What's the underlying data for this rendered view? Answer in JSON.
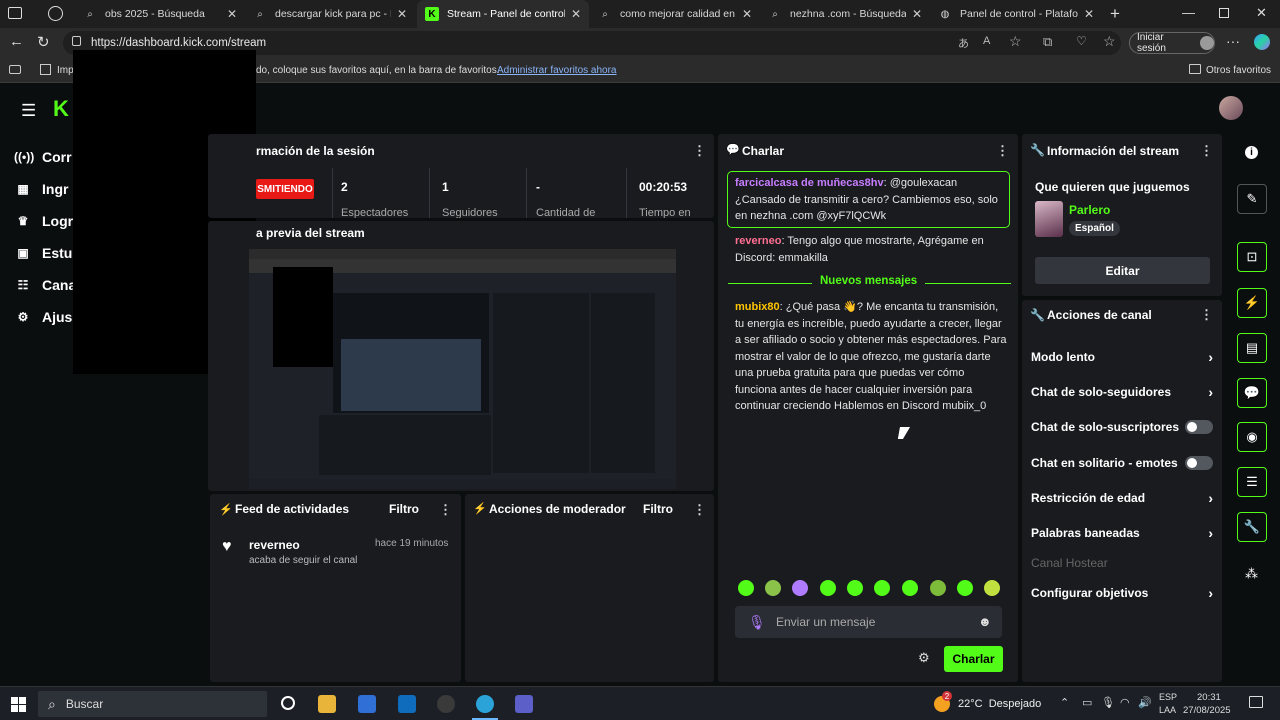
{
  "browser": {
    "tabs": [
      {
        "title": "obs 2025 - Búsqueda",
        "icon": "search-icon"
      },
      {
        "title": "descargar kick para pc - Búsque",
        "icon": "search-icon"
      },
      {
        "title": "Stream - Panel de control de",
        "icon": "kick-icon",
        "active": true
      },
      {
        "title": "como mejorar calidad en kick",
        "icon": "search-icon"
      },
      {
        "title": "nezhna .com - Búsqueda",
        "icon": "search-icon"
      },
      {
        "title": "Panel de control - Plataforma",
        "icon": "globe-icon"
      }
    ],
    "url": "https://dashboard.kick.com/stream",
    "signin_label": "Iniciar sesión",
    "favbar_prefix": "Imp",
    "favbar_text": "do, coloque sus favoritos aquí, en la barra de favoritos.",
    "favbar_link": "Administrar favoritos ahora",
    "other_favs": "Otros favoritos"
  },
  "sidebar": {
    "items": [
      {
        "label": "Corr",
        "icon": "broadcast-icon"
      },
      {
        "label": "Ingr",
        "icon": "chart-icon"
      },
      {
        "label": "Logr",
        "icon": "trophy-icon"
      },
      {
        "label": "Estu",
        "icon": "studio-icon"
      },
      {
        "label": "Cana",
        "icon": "channel-icon"
      },
      {
        "label": "Ajus",
        "icon": "gear-icon"
      }
    ]
  },
  "session": {
    "title": "rmación de la sesión",
    "live_badge": "SMITIENDO",
    "stats": [
      {
        "value": "2",
        "label": "Espectadores"
      },
      {
        "value": "1",
        "label": "Seguidores"
      },
      {
        "value": "-",
        "label": "Cantidad de"
      },
      {
        "value": "00:20:53",
        "label": "Tiempo en"
      }
    ]
  },
  "preview": {
    "title": "a previa del stream"
  },
  "activity": {
    "title": "Feed de actividades",
    "filter": "Filtro",
    "items": [
      {
        "user": "reverneo",
        "time": "hace 19 minutos",
        "text": "acaba de seguir el canal"
      }
    ]
  },
  "moderator": {
    "title": "Acciones de moderador",
    "filter": "Filtro"
  },
  "chat": {
    "title": "Charlar",
    "pinned": {
      "user": "farcicalcasa de muñecas8hv",
      "text": ": @goulexacan ¿Cansado de transmitir a cero? Cambiemos eso, solo en nezhna .com @xyF7lQCWk"
    },
    "msg1": {
      "user": "reverneo",
      "text": ": Tengo algo que mostrarte, Agrégame en Discord: emmakilla"
    },
    "divider": "Nuevos mensajes",
    "msg2": {
      "user": "mubix80",
      "text": ": ¿Qué pasa 👋? Me encanta tu transmisión, tu energía es increíble, puedo ayudarte a crecer, llegar a ser afiliado o socio y obtener más espectadores. Para mostrar el valor de lo que ofrezco, me gustaría darte una prueba gratuita para que puedas ver cómo funciona antes de hacer cualquier inversión para continuar creciendo Hablemos en Discord mubiix_0"
    },
    "input_placeholder": "Enviar un mensaje",
    "send_label": "Charlar"
  },
  "stream_info": {
    "title": "Información del stream",
    "stream_title": "Que quieren que juguemos",
    "category": "Parlero",
    "language": "Español",
    "edit_label": "Editar"
  },
  "channel_actions": {
    "title": "Acciones de canal",
    "items": [
      {
        "label": "Modo lento",
        "control": "chevron"
      },
      {
        "label": "Chat de solo-seguidores",
        "control": "chevron"
      },
      {
        "label": "Chat de solo-suscriptores",
        "control": "toggle"
      },
      {
        "label": "Chat en solitario - emotes",
        "control": "toggle"
      },
      {
        "label": "Restricción de edad",
        "control": "chevron"
      },
      {
        "label": "Palabras baneadas",
        "control": "chevron"
      },
      {
        "label": "Canal Hostear",
        "control": "none",
        "disabled": true
      },
      {
        "label": "Configurar objetivos",
        "control": "chevron"
      }
    ]
  },
  "taskbar": {
    "search": "Buscar",
    "weather_badge": "2",
    "weather": "22°C  Despejado",
    "lang1": "ESP",
    "lang2": "LAA",
    "time": "20:31",
    "date": "27/08/2025"
  },
  "colors": {
    "accent": "#53fc18",
    "live": "#e91916",
    "panel": "#191b1f",
    "bg": "#0b0e0f"
  }
}
